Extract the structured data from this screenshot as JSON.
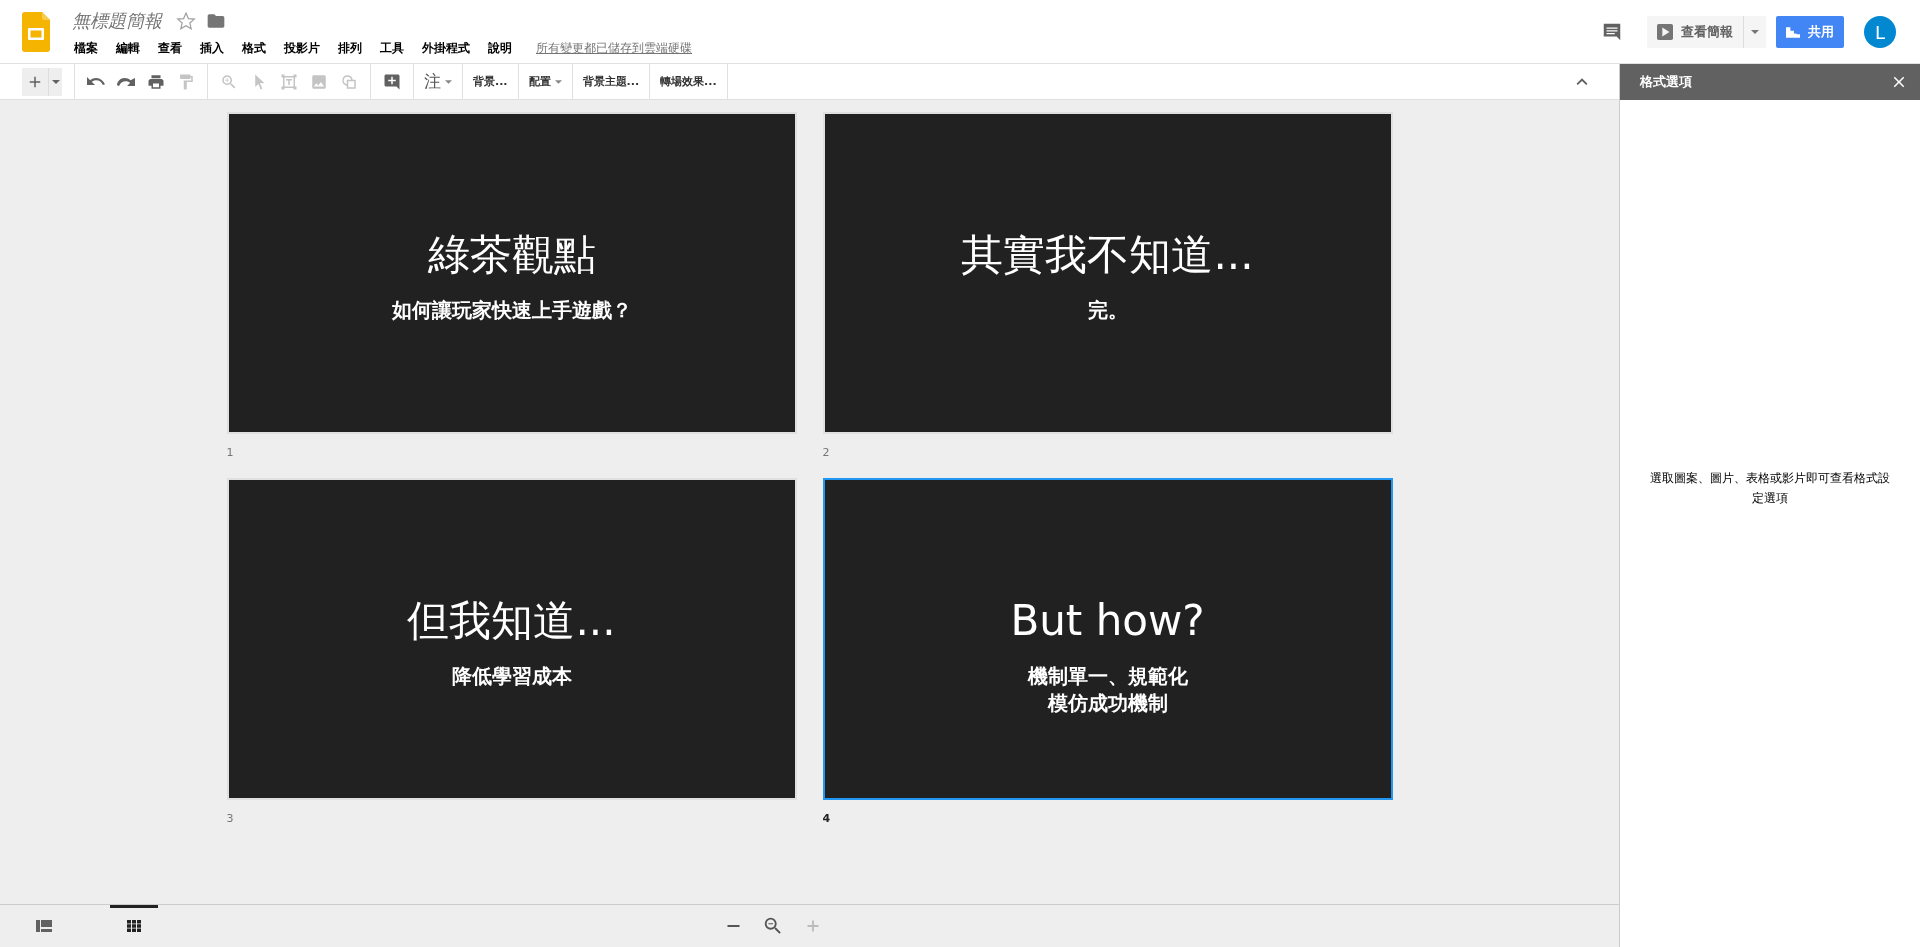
{
  "header": {
    "title": "無標題簡報",
    "starred": false,
    "menus": [
      "檔案",
      "編輯",
      "查看",
      "插入",
      "格式",
      "投影片",
      "排列",
      "工具",
      "外掛程式",
      "說明"
    ],
    "save_status": "所有變更都已儲存到雲端硬碟"
  },
  "actions": {
    "present_label": "查看簡報",
    "share_label": "共用",
    "avatar_letter": "L"
  },
  "toolbar": {
    "tools": [
      {
        "disabled": false
      },
      {
        "disabled": false
      },
      {
        "disabled": false
      },
      {
        "disabled": false
      },
      {
        "disabled": false
      },
      {
        "disabled": true
      },
      {
        "disabled": true
      },
      {
        "disabled": true
      },
      {
        "disabled": true
      },
      {
        "disabled": true
      },
      {
        "disabled": true
      },
      {
        "disabled": false
      }
    ],
    "text_buttons": [
      {
        "label": "注",
        "dropdown": true
      },
      {
        "label": "背景...",
        "dropdown": false
      },
      {
        "label": "配置",
        "dropdown": true
      },
      {
        "label": "背景主題...",
        "dropdown": false
      },
      {
        "label": "轉場效果...",
        "dropdown": false
      }
    ]
  },
  "slides": [
    {
      "number": "1",
      "title": "綠茶觀點",
      "subtitle": [
        "如何讓玩家快速上手遊戲？"
      ],
      "selected": false
    },
    {
      "number": "2",
      "title": "其實我不知道...",
      "subtitle": [
        "完。"
      ],
      "selected": false
    },
    {
      "number": "3",
      "title": "但我知道...",
      "subtitle": [
        "降低學習成本"
      ],
      "selected": false
    },
    {
      "number": "4",
      "title": "But how?",
      "subtitle": [
        "機制單一、規範化",
        "模仿成功機制"
      ],
      "selected": true
    }
  ],
  "side_panel": {
    "title": "格式選項",
    "message": "選取圖案、圖片、表格或影片即可查看格式設定選項"
  },
  "bottom_bar": {
    "views": [
      {
        "selected": false
      },
      {
        "selected": true
      }
    ],
    "zoom_controls": [
      {
        "disabled": false
      },
      {
        "disabled": false
      },
      {
        "disabled": true
      }
    ]
  }
}
